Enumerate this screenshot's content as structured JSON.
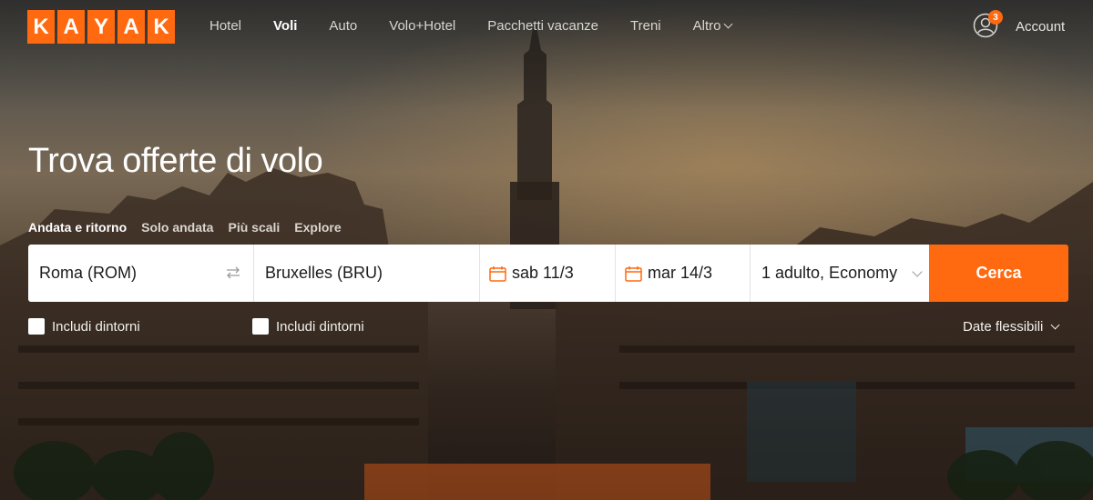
{
  "brand": {
    "letters": [
      "K",
      "A",
      "Y",
      "A",
      "K"
    ],
    "accent": "#ff690f"
  },
  "nav": {
    "items": [
      {
        "label": "Hotel",
        "active": false
      },
      {
        "label": "Voli",
        "active": true
      },
      {
        "label": "Auto",
        "active": false
      },
      {
        "label": "Volo+Hotel",
        "active": false
      },
      {
        "label": "Pacchetti vacanze",
        "active": false
      },
      {
        "label": "Treni",
        "active": false
      },
      {
        "label": "Altro",
        "active": false
      }
    ]
  },
  "account": {
    "label": "Account",
    "notifications": "3"
  },
  "hero": {
    "title": "Trova offerte di volo"
  },
  "trip_types": [
    {
      "label": "Andata e ritorno",
      "active": true
    },
    {
      "label": "Solo andata",
      "active": false
    },
    {
      "label": "Più scali",
      "active": false
    },
    {
      "label": "Explore",
      "active": false
    }
  ],
  "search": {
    "origin": "Roma (ROM)",
    "destination": "Bruxelles (BRU)",
    "depart_date": "sab 11/3",
    "return_date": "mar 14/3",
    "passengers": "1 adulto, Economy",
    "submit_label": "Cerca"
  },
  "options": {
    "origin_nearby": "Includi dintorni",
    "destination_nearby": "Includi dintorni",
    "flexible_dates": "Date flessibili"
  }
}
